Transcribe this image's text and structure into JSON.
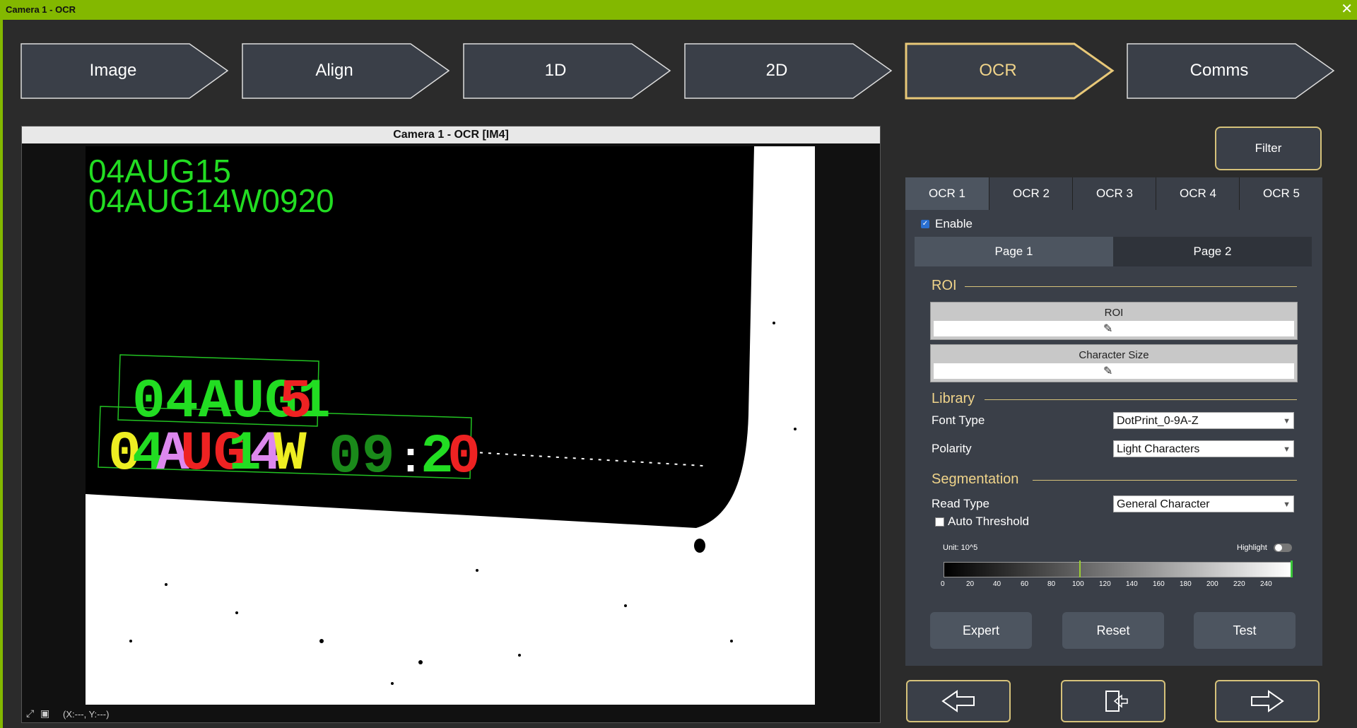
{
  "window": {
    "title": "Camera 1 - OCR",
    "close_icon": "close-icon"
  },
  "steps": [
    "Image",
    "Align",
    "1D",
    "2D",
    "OCR",
    "Comms"
  ],
  "active_step": "OCR",
  "viewer": {
    "title": "Camera 1 - OCR  [IM4]",
    "status": "(X:---, Y:---)",
    "results": [
      "04AUG15",
      "04AUG14W0920"
    ]
  },
  "filter_button": "Filter",
  "ocr_tabs": [
    "OCR 1",
    "OCR 2",
    "OCR 3",
    "OCR 4",
    "OCR 5"
  ],
  "enable_label": "Enable",
  "page_tabs": [
    "Page 1",
    "Page 2"
  ],
  "roi": {
    "section": "ROI",
    "roi_label": "ROI",
    "char_size_label": "Character Size"
  },
  "library": {
    "section": "Library",
    "font_type_label": "Font Type",
    "font_type_value": "DotPrint_0-9A-Z",
    "polarity_label": "Polarity",
    "polarity_value": "Light Characters"
  },
  "segmentation": {
    "section": "Segmentation",
    "read_type_label": "Read Type",
    "read_type_value": "General Character",
    "auto_threshold_label": "Auto Threshold",
    "unit_label": "Unit: 10^5",
    "highlight_label": "Highlight",
    "ticks": [
      "0",
      "20",
      "40",
      "60",
      "80",
      "100",
      "120",
      "140",
      "160",
      "180",
      "200",
      "220",
      "240"
    ]
  },
  "panel_buttons": [
    "Expert",
    "Reset",
    "Test"
  ]
}
